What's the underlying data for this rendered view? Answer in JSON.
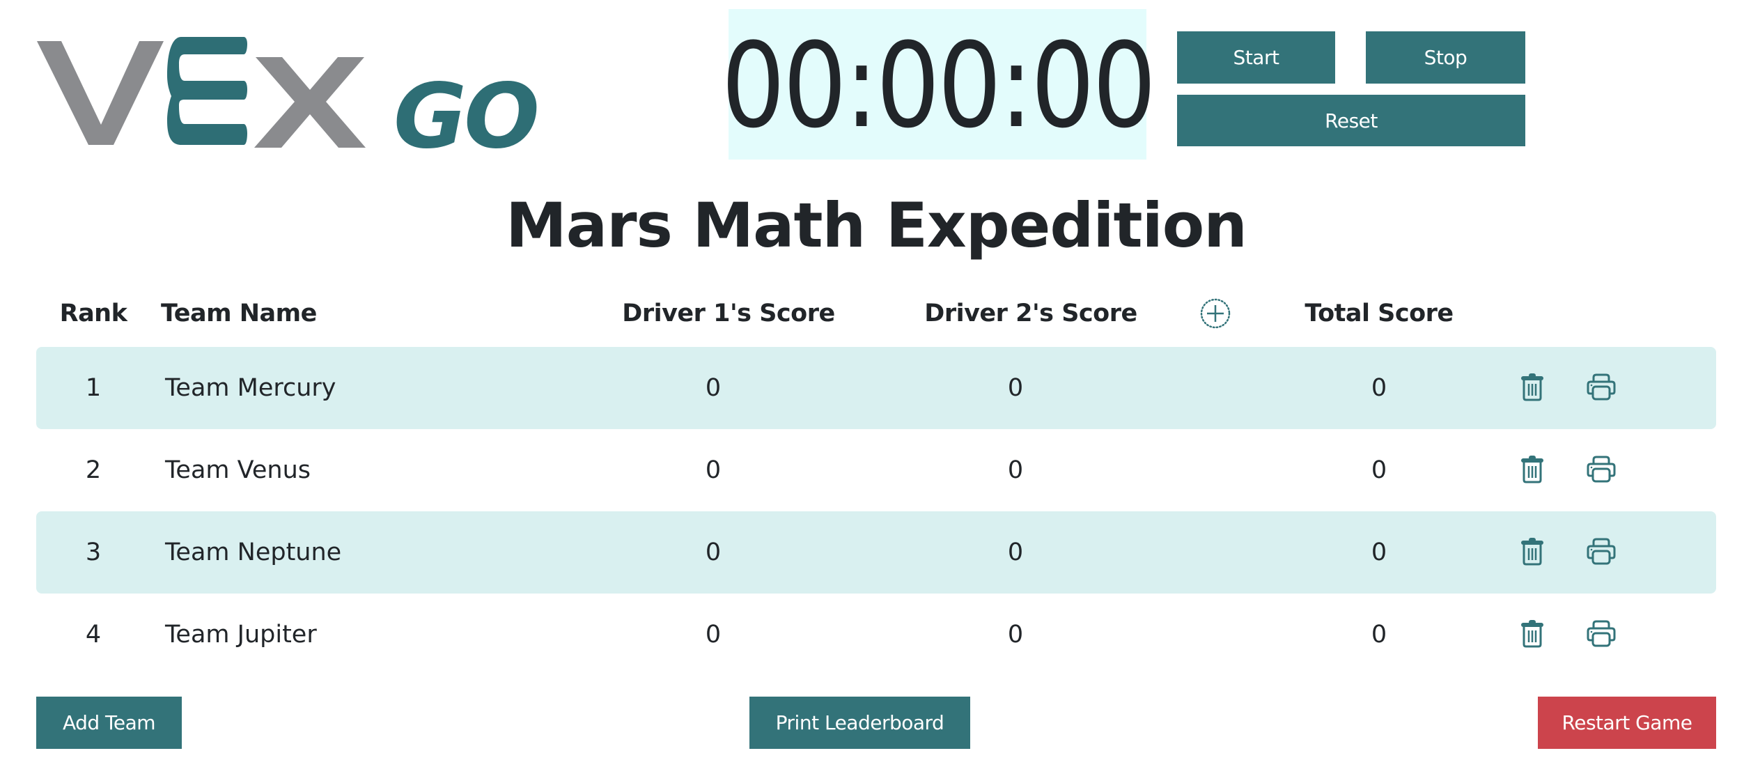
{
  "logo": {
    "text_vex": "VEX",
    "text_go": "GO",
    "alt": "VEX GO logo"
  },
  "timer": {
    "value": "00:00:00"
  },
  "controls": {
    "start_label": "Start",
    "stop_label": "Stop",
    "reset_label": "Reset"
  },
  "page_title": "Mars Math Expedition",
  "table": {
    "headers": {
      "rank": "Rank",
      "team_name": "Team Name",
      "driver1": "Driver 1's Score",
      "driver2": "Driver 2's Score",
      "total": "Total Score"
    },
    "add_column_icon": "plus-circle-icon",
    "rows": [
      {
        "rank": "1",
        "team": "Team Mercury",
        "driver1": "0",
        "driver2": "0",
        "total": "0"
      },
      {
        "rank": "2",
        "team": "Team Venus",
        "driver1": "0",
        "driver2": "0",
        "total": "0"
      },
      {
        "rank": "3",
        "team": "Team Neptune",
        "driver1": "0",
        "driver2": "0",
        "total": "0"
      },
      {
        "rank": "4",
        "team": "Team Jupiter",
        "driver1": "0",
        "driver2": "0",
        "total": "0"
      }
    ],
    "row_actions": [
      "trash-icon",
      "printer-icon"
    ]
  },
  "footer": {
    "add_team_label": "Add Team",
    "print_leaderboard_label": "Print Leaderboard",
    "restart_label": "Restart Game"
  },
  "colors": {
    "primary": "#337379",
    "danger": "#cc444c",
    "row_alt": "#d9f0f0",
    "timer_bg": "#e3fcfc",
    "logo_gray": "#8a8b8e",
    "logo_teal": "#2e6e75"
  }
}
